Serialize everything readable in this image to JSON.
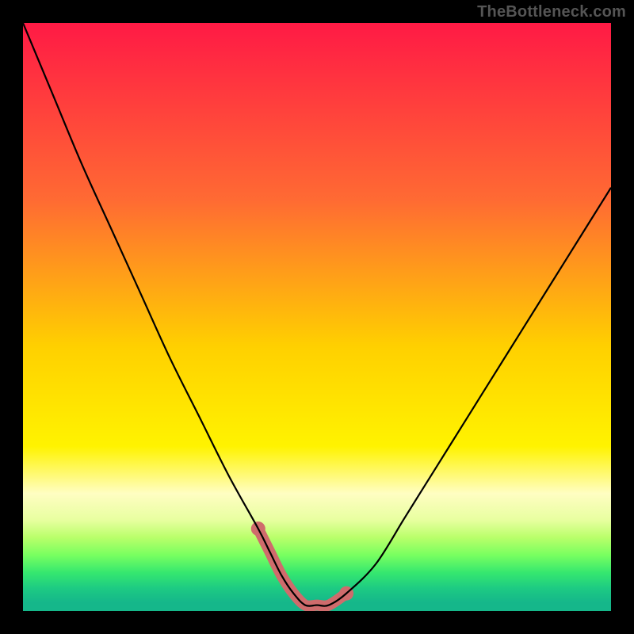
{
  "watermark": "TheBottleneck.com",
  "chart_data": {
    "type": "line",
    "title": "",
    "xlabel": "",
    "ylabel": "",
    "x": [
      0,
      5,
      10,
      15,
      20,
      25,
      30,
      35,
      40,
      42,
      44,
      46,
      48,
      50,
      52,
      55,
      60,
      65,
      70,
      75,
      80,
      85,
      90,
      95,
      100
    ],
    "y": [
      100,
      88,
      76,
      65,
      54,
      43,
      33,
      23,
      14,
      10,
      6,
      3,
      1,
      1,
      1,
      3,
      8,
      16,
      24,
      32,
      40,
      48,
      56,
      64,
      72
    ],
    "xlim": [
      0,
      100
    ],
    "ylim": [
      0,
      100
    ],
    "overlays": {
      "band": {
        "x": [
          40,
          42,
          44,
          46,
          48,
          50,
          52,
          55
        ],
        "y": [
          14,
          10,
          6,
          3,
          1,
          1,
          1,
          3
        ],
        "stroke": "#cf6b6c",
        "width": 14,
        "end_dots": true
      }
    },
    "background_gradient": [
      {
        "offset": 0.0,
        "color": "#ff1a45"
      },
      {
        "offset": 0.3,
        "color": "#ff6a33"
      },
      {
        "offset": 0.55,
        "color": "#ffd000"
      },
      {
        "offset": 0.72,
        "color": "#fff300"
      },
      {
        "offset": 0.8,
        "color": "#fffec2"
      },
      {
        "offset": 0.845,
        "color": "#e8ffa0"
      },
      {
        "offset": 0.875,
        "color": "#b9ff6a"
      },
      {
        "offset": 0.905,
        "color": "#78ff60"
      },
      {
        "offset": 0.935,
        "color": "#35e76f"
      },
      {
        "offset": 0.962,
        "color": "#1dca83"
      },
      {
        "offset": 0.985,
        "color": "#15b78a"
      },
      {
        "offset": 1.0,
        "color": "#15b78a"
      }
    ],
    "curve_stroke": "#000000",
    "curve_width": 2.2
  }
}
